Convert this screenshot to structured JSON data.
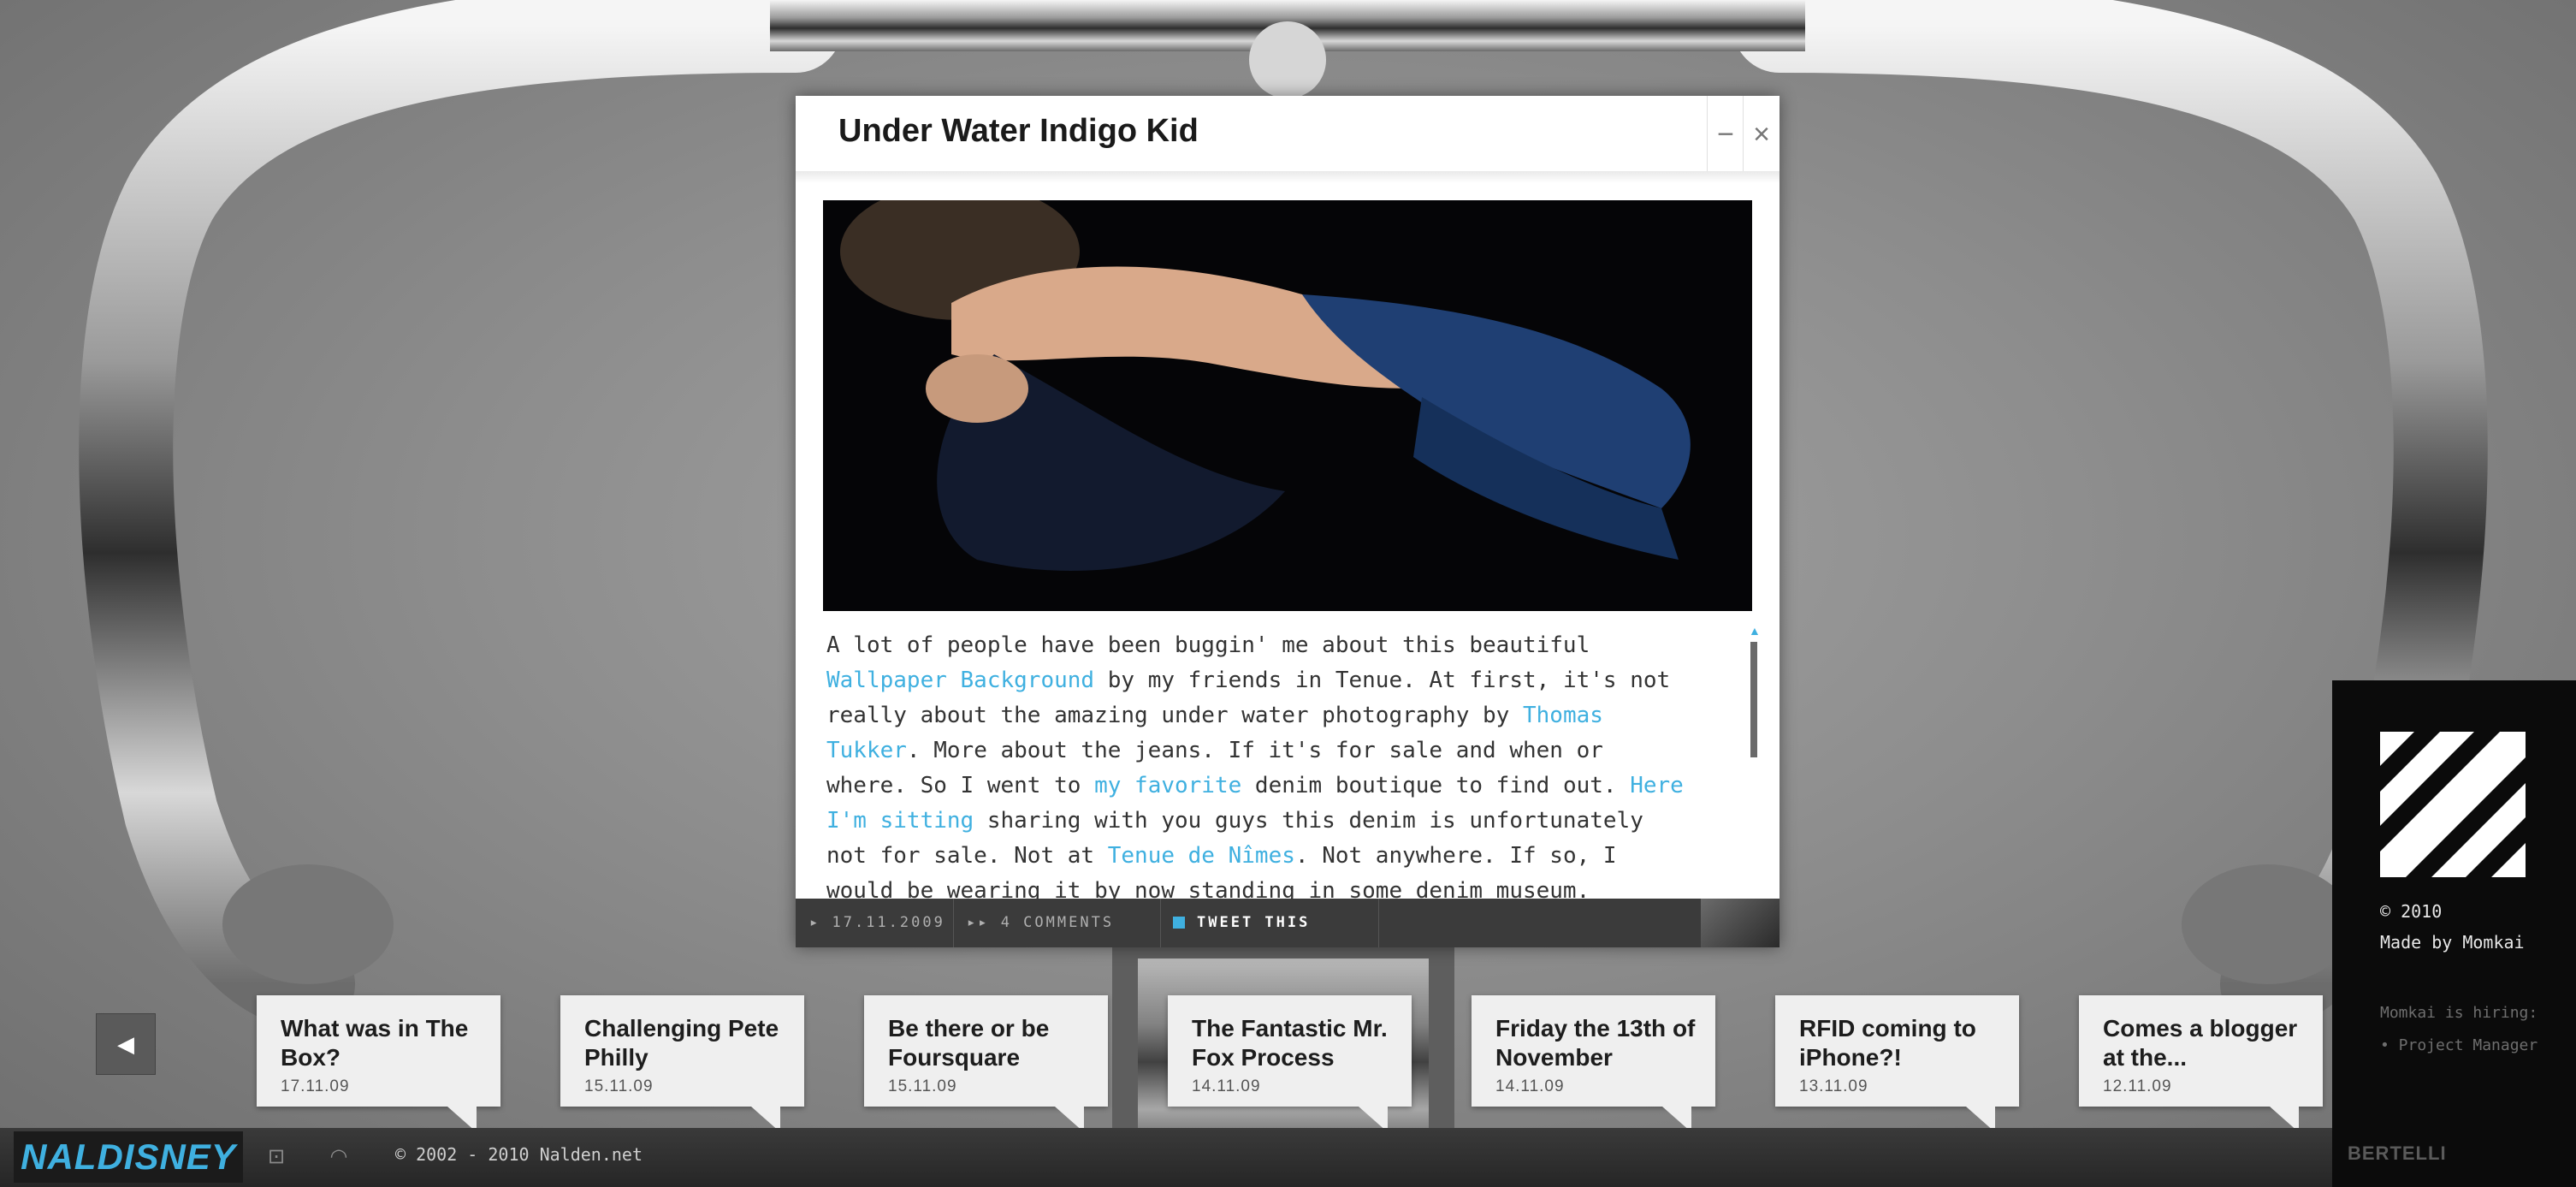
{
  "popup": {
    "title": "Under Water Indigo Kid",
    "min_label": "−",
    "close_label": "×",
    "body_parts": [
      {
        "text": "A lot of people have been buggin' me about this beautiful ",
        "link": false
      },
      {
        "text": "Wallpaper Background",
        "link": true
      },
      {
        "text": " by my friends in Tenue. At first, it's not really about the amazing under water photography by ",
        "link": false
      },
      {
        "text": "Thomas Tukker",
        "link": true
      },
      {
        "text": ". More about the jeans. If it's for sale and when or where. So I went to ",
        "link": false
      },
      {
        "text": "my favorite",
        "link": true
      },
      {
        "text": " denim boutique to find out. ",
        "link": false
      },
      {
        "text": "Here I'm sitting",
        "link": true
      },
      {
        "text": " sharing with you guys this denim is unfortunately not for sale. Not at ",
        "link": false
      },
      {
        "text": "Tenue de Nîmes",
        "link": true
      },
      {
        "text": ". Not anywhere. If so, I would be wearing it by now standing in some denim museum.",
        "link": false
      }
    ],
    "footer": {
      "date": "▸ 17.11.2009",
      "comments": "▸▸ 4 COMMENTS",
      "tweet": "TWEET THIS"
    }
  },
  "side": {
    "copyright": "© 2010",
    "made_by": "Made by Momkai",
    "hiring": "Momkai is hiring:",
    "job": "• Project Manager",
    "brand": "BERTELLI"
  },
  "carousel": {
    "prev_label": "◀",
    "posts": [
      {
        "title": "What was in The Box?",
        "date": "17.11.09"
      },
      {
        "title": "Challenging Pete Philly",
        "date": "15.11.09"
      },
      {
        "title": "Be there or be Foursquare",
        "date": "15.11.09"
      },
      {
        "title": "The Fantastic Mr. Fox Process",
        "date": "14.11.09"
      },
      {
        "title": "Friday the 13th of November",
        "date": "14.11.09"
      },
      {
        "title": "RFID coming to iPhone?!",
        "date": "13.11.09"
      },
      {
        "title": "Comes a blogger at the...",
        "date": "12.11.09"
      }
    ]
  },
  "bottom": {
    "logo": "NALDISNEY",
    "copyright": "© 2002 - 2010 Nalden.net"
  },
  "colors": {
    "accent": "#3fb0e0",
    "panel": "#0b0b0b"
  }
}
